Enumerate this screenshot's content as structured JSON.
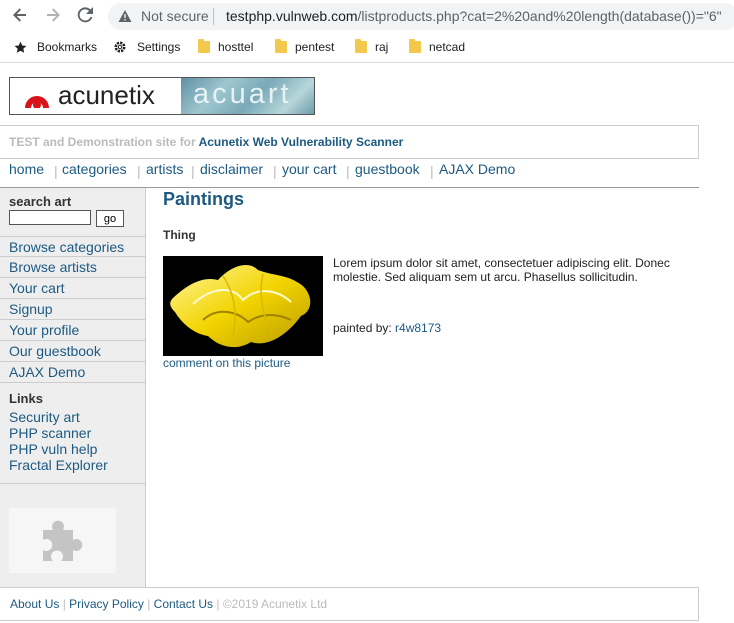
{
  "browser": {
    "security_text": "Not secure",
    "url_host": "testphp.vulnweb.com",
    "url_path": "/listproducts.php?cat=2%20and%20length(database())=\"6\"",
    "bookmarks": [
      {
        "label": "Bookmarks",
        "icon": "star-icon"
      },
      {
        "label": "Settings",
        "icon": "gear-icon"
      },
      {
        "label": "hosttel",
        "icon": "folder-icon"
      },
      {
        "label": "pentest",
        "icon": "folder-icon"
      },
      {
        "label": "raj",
        "icon": "folder-icon"
      },
      {
        "label": "netcad",
        "icon": "folder-icon"
      }
    ]
  },
  "site": {
    "logo_text": "acunetix",
    "logo_secondary": "acuart",
    "tagline_prefix": "TEST and Demonstration site for ",
    "tagline_strong": "Acunetix Web Vulnerability Scanner",
    "topnav": [
      "home",
      "categories",
      "artists",
      "disclaimer",
      "your cart",
      "guestbook",
      "AJAX Demo"
    ],
    "sidebar": {
      "search_title": "search art",
      "search_value": "",
      "go_label": "go",
      "links": [
        "Browse categories",
        "Browse artists",
        "Your cart",
        "Signup",
        "Your profile",
        "Our guestbook",
        "AJAX Demo"
      ],
      "links_title": "Links",
      "external_links": [
        "Security art",
        "PHP scanner",
        "PHP vuln help",
        "Fractal Explorer"
      ]
    },
    "main": {
      "title": "Paintings",
      "item_title": "Thing",
      "description": "Lorem ipsum dolor sit amet, consectetuer adipiscing elit. Donec molestie. Sed aliquam sem ut arcu. Phasellus sollicitudin.",
      "painted_by_label": "painted by: ",
      "artist": "r4w8173",
      "comment_link": "comment on this picture"
    },
    "footer": {
      "links": [
        "About Us",
        "Privacy Policy",
        "Contact Us"
      ],
      "copyright": "©2019 Acunetix Ltd"
    }
  },
  "colors": {
    "link": "#1c5a82",
    "sidebar_bg": "#eeeeee",
    "muted": "#bbbbbb"
  }
}
